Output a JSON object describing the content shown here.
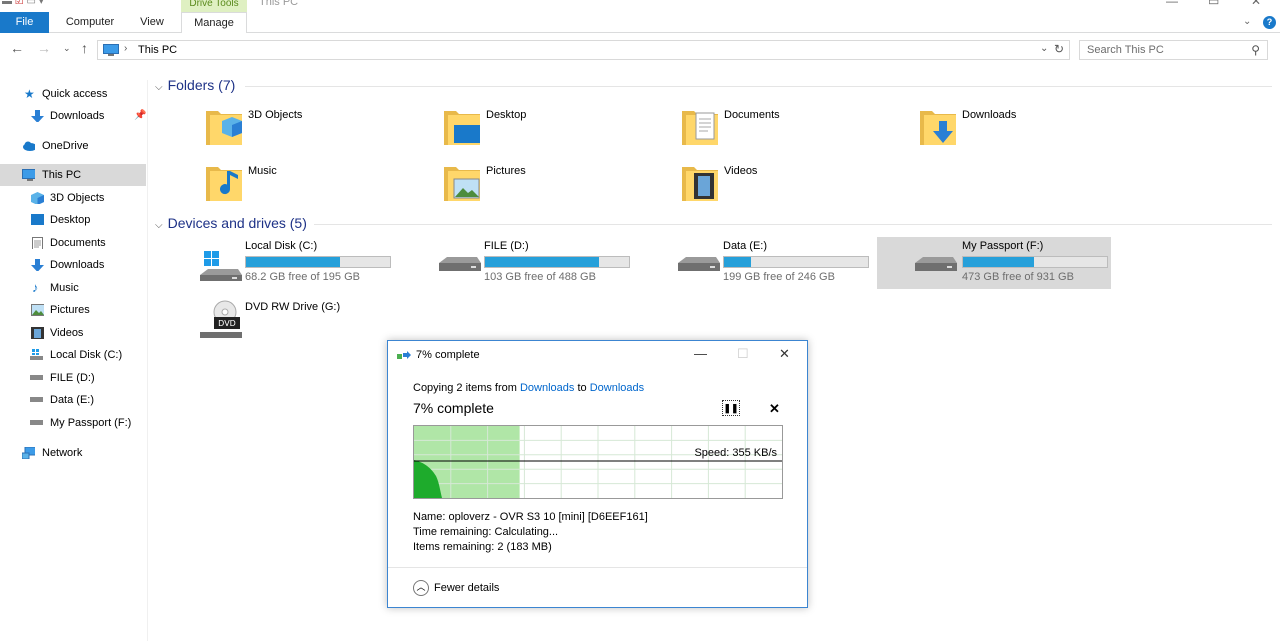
{
  "ribbon": {
    "tabs": [
      "File",
      "Computer",
      "View",
      "Manage"
    ],
    "contextual_group": "Drive Tools",
    "window_title": "This PC"
  },
  "address": {
    "path": "This PC",
    "search_placeholder": "Search This PC"
  },
  "sidebar": {
    "items": [
      {
        "label": "Quick access",
        "icon": "star-icon"
      },
      {
        "label": "Downloads",
        "icon": "download-arrow-icon",
        "pinned": true
      },
      {
        "label": "OneDrive",
        "icon": "cloud-icon"
      },
      {
        "label": "This PC",
        "icon": "computer-icon",
        "selected": true
      },
      {
        "label": "3D Objects",
        "icon": "cube-icon"
      },
      {
        "label": "Desktop",
        "icon": "desktop-icon"
      },
      {
        "label": "Documents",
        "icon": "document-icon"
      },
      {
        "label": "Downloads",
        "icon": "download-arrow-icon"
      },
      {
        "label": "Music",
        "icon": "music-note-icon"
      },
      {
        "label": "Pictures",
        "icon": "picture-icon"
      },
      {
        "label": "Videos",
        "icon": "film-icon"
      },
      {
        "label": "Local Disk (C:)",
        "icon": "windows-drive-icon"
      },
      {
        "label": "FILE (D:)",
        "icon": "drive-icon"
      },
      {
        "label": "Data (E:)",
        "icon": "drive-icon"
      },
      {
        "label": "My Passport (F:)",
        "icon": "drive-icon"
      },
      {
        "label": "Network",
        "icon": "network-icon"
      }
    ]
  },
  "folders": {
    "heading": "Folders (7)",
    "items": [
      {
        "label": "3D Objects"
      },
      {
        "label": "Desktop"
      },
      {
        "label": "Documents"
      },
      {
        "label": "Downloads"
      },
      {
        "label": "Music"
      },
      {
        "label": "Pictures"
      },
      {
        "label": "Videos"
      }
    ]
  },
  "drives": {
    "heading": "Devices and drives (5)",
    "items": [
      {
        "label": "Local Disk (C:)",
        "free": "68.2 GB free of 195 GB",
        "used_fraction": 0.65
      },
      {
        "label": "FILE (D:)",
        "free": "103 GB free of 488 GB",
        "used_fraction": 0.79
      },
      {
        "label": "Data (E:)",
        "free": "199 GB free of 246 GB",
        "used_fraction": 0.19
      },
      {
        "label": "My Passport (F:)",
        "free": "473 GB free of 931 GB",
        "used_fraction": 0.49,
        "selected": true
      },
      {
        "label": "DVD RW Drive (G:)"
      }
    ]
  },
  "dialog": {
    "title": "7% complete",
    "copying_prefix": "Copying 2 items from ",
    "from": "Downloads",
    "to_word": " to ",
    "to": "Downloads",
    "percent_text": "7% complete",
    "progress_fraction": 0.07,
    "speed": "Speed: 355 KB/s",
    "name_line": "Name:  oploverz - OVR S3 10 [mini] [D6EEF161]",
    "time_line": "Time remaining:  Calculating...",
    "items_line": "Items remaining:  2 (183 MB)",
    "fewer_details": "Fewer details"
  }
}
